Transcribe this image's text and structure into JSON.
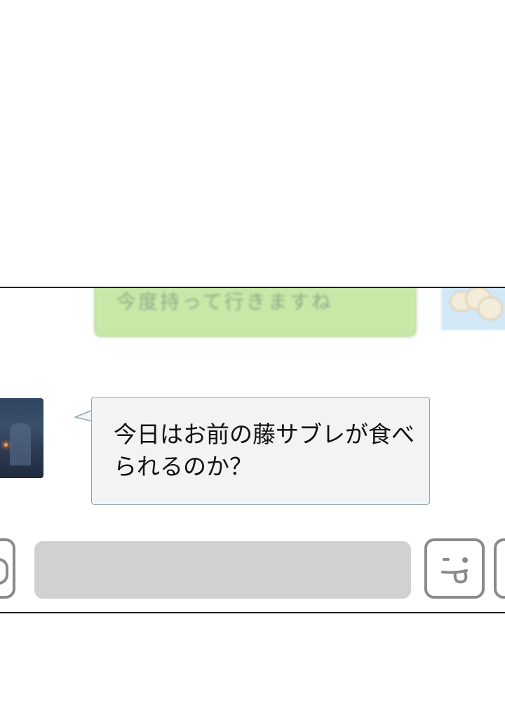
{
  "chat": {
    "sent_message": {
      "text": "今度持って行きますね",
      "bubble_color": "#bfe59a"
    },
    "received_message": {
      "text": "今日はお前の藤サブレが食べられるのか？",
      "bubble_color": "#f2f3f5",
      "border_color": "#8fa3b5"
    }
  },
  "input_bar": {
    "field_color": "#d1d1d1",
    "left_icon": "attach-icon",
    "emoji_icon": "tongue-out-emoji-icon",
    "right_icon": "more-icon"
  }
}
